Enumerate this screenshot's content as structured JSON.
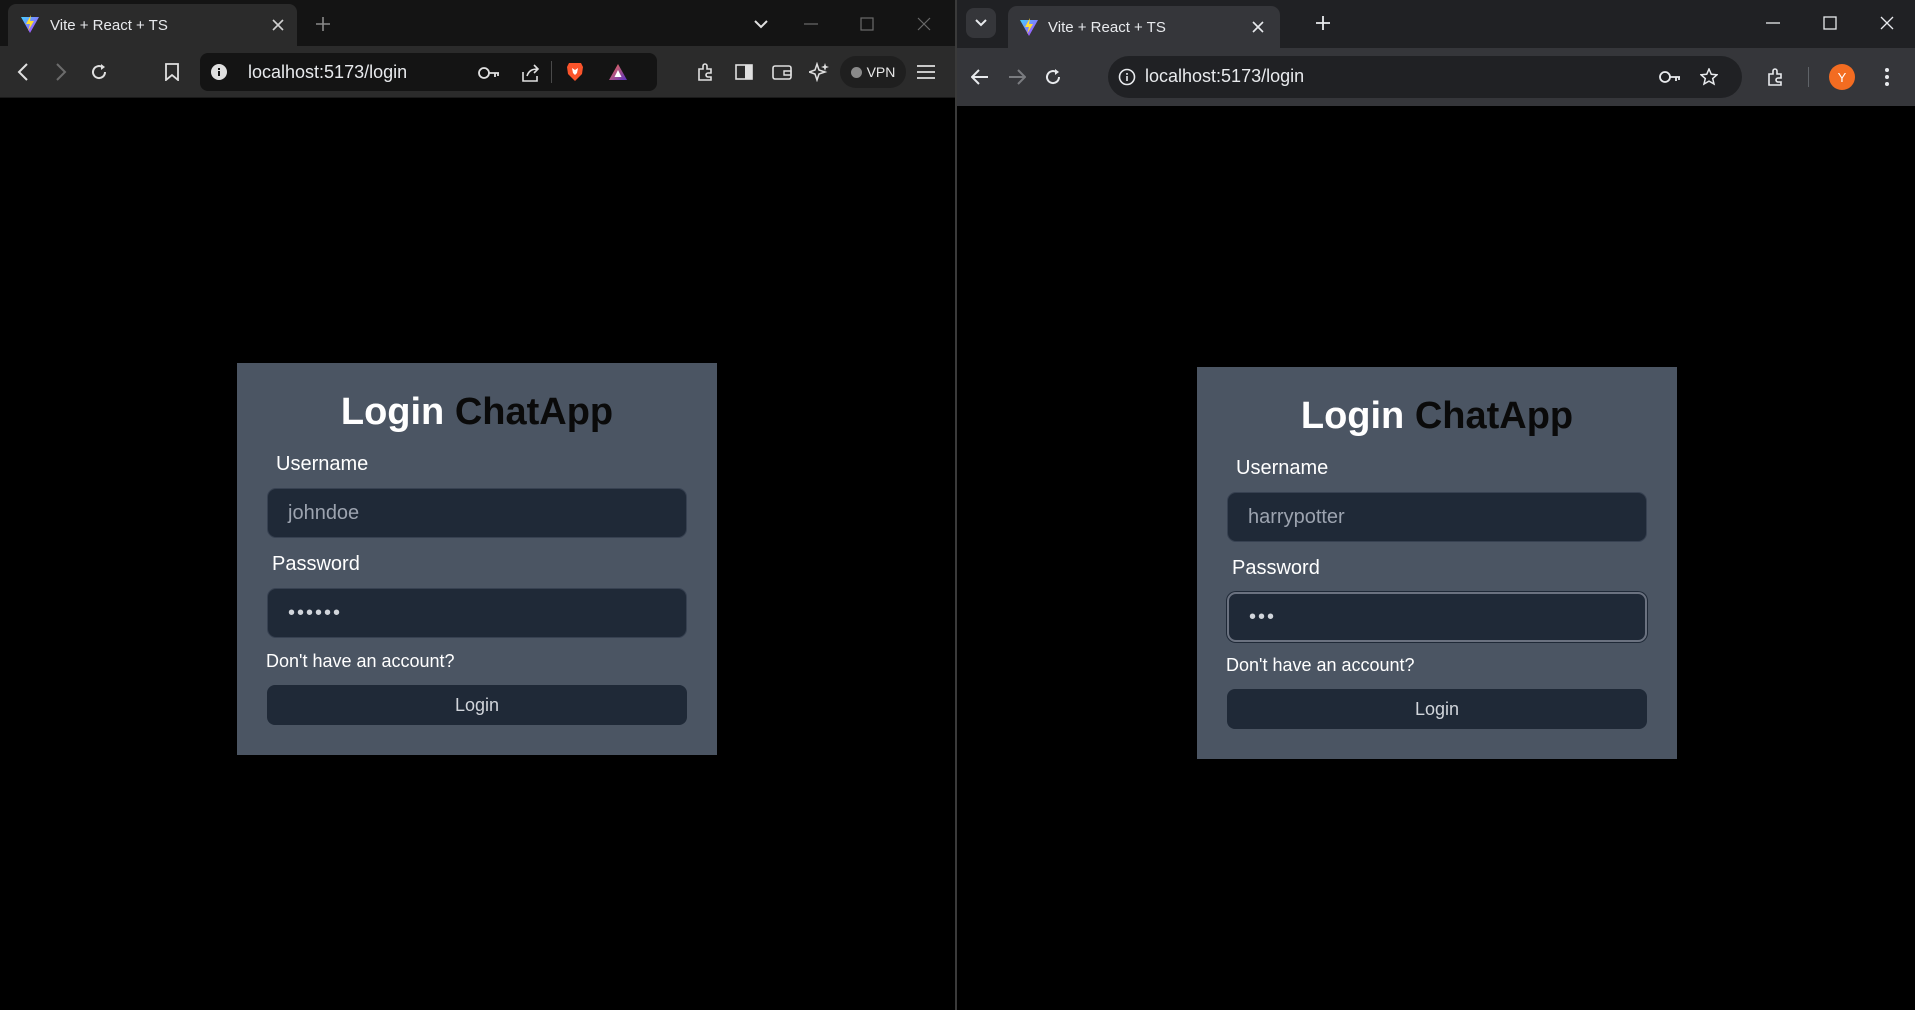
{
  "left_browser": {
    "tab": {
      "title": "Vite + React + TS"
    },
    "address_bar": {
      "url": "localhost:5173/login"
    },
    "vpn_label": "VPN"
  },
  "right_browser": {
    "tab": {
      "title": "Vite + React + TS"
    },
    "address_bar": {
      "url": "localhost:5173/login"
    },
    "profile_initial": "Y"
  },
  "left_login": {
    "title": "Login",
    "brand": "ChatApp",
    "username_label": "Username",
    "username_value": "johndoe",
    "password_label": "Password",
    "password_value": "••••••",
    "signup_link": "Don't have an account?",
    "login_button": "Login"
  },
  "right_login": {
    "title": "Login",
    "brand": "ChatApp",
    "username_label": "Username",
    "username_value": "harrypotter",
    "password_label": "Password",
    "password_value": "•••",
    "signup_link": "Don't have an account?",
    "login_button": "Login"
  },
  "colors": {
    "page_background": "#000000",
    "card_background": "#4b5563",
    "input_background": "#1f2937",
    "brand_text": "#0a0a0a",
    "profile_avatar": "#f36c21"
  }
}
